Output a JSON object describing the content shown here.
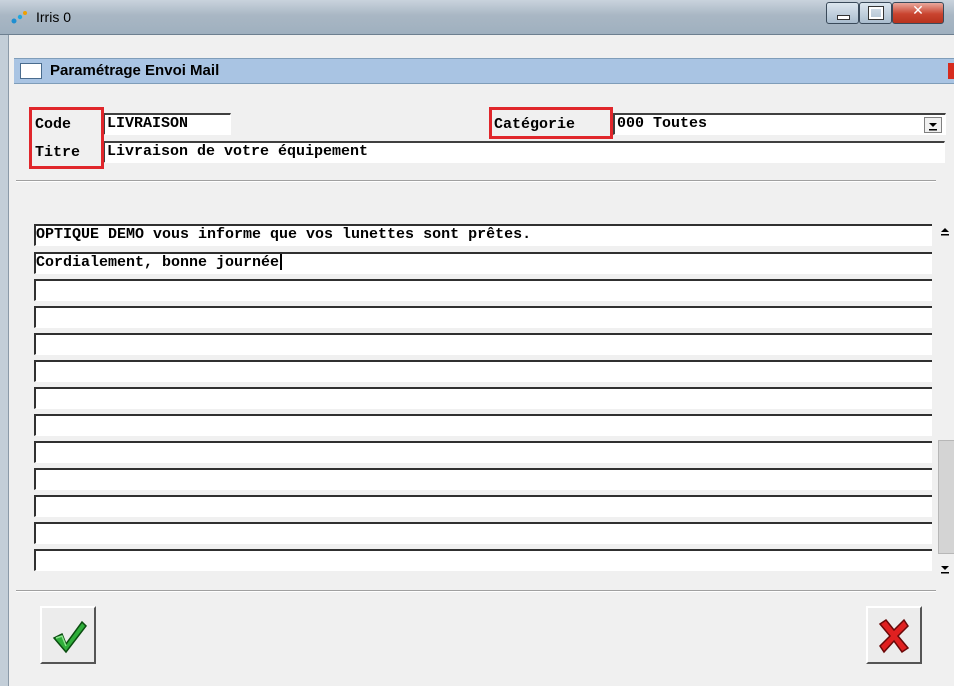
{
  "window": {
    "title": "Irris 0"
  },
  "dialog": {
    "title": "Paramétrage Envoi Mail"
  },
  "form": {
    "code_label": "Code",
    "code_value": "LIVRAISON",
    "titre_label": "Titre",
    "titre_value": "Livraison de votre équipement",
    "categorie_label": "Catégorie",
    "categorie_value": "000 Toutes"
  },
  "message_lines": [
    "OPTIQUE DEMO vous informe que vos lunettes sont prêtes.",
    "Cordialement, bonne journée",
    "",
    "",
    "",
    "",
    "",
    "",
    "",
    "",
    "",
    "",
    ""
  ],
  "colors": {
    "highlight": "#e0262b",
    "confirm": "#3cb043",
    "cancel": "#e02020"
  },
  "icons": {
    "confirm": "checkmark-icon",
    "cancel": "x-icon"
  }
}
